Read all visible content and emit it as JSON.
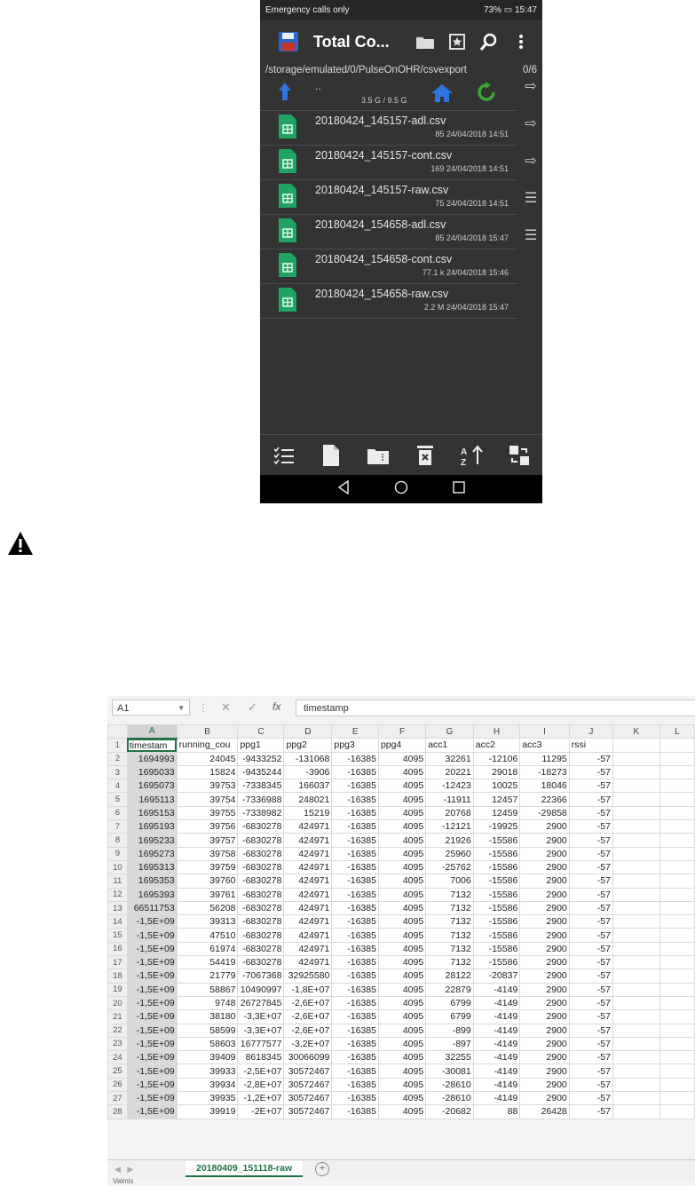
{
  "phone": {
    "status": {
      "left": "Emergency calls only",
      "battery": "73%",
      "time": "15:47"
    },
    "toolbar": {
      "title": "Total Co...",
      "icons": [
        "save-icon",
        "folder-icon",
        "bookmark-icon",
        "search-icon",
        "more-icon"
      ]
    },
    "path": "/storage/emulated/0/PulseOnOHR/csvexport",
    "count": "0/6",
    "updir": {
      "label": "..",
      "space": "3.5 G / 9.5 G"
    },
    "files": [
      {
        "name": "20180424_145157-adl.csv",
        "size": "85",
        "date": "24/04/2018 14:51"
      },
      {
        "name": "20180424_145157-cont.csv",
        "size": "169",
        "date": "24/04/2018 14:51"
      },
      {
        "name": "20180424_145157-raw.csv",
        "size": "75",
        "date": "24/04/2018 14:51"
      },
      {
        "name": "20180424_154658-adl.csv",
        "size": "85",
        "date": "24/04/2018 15:47"
      },
      {
        "name": "20180424_154658-cont.csv",
        "size": "77.1 k",
        "date": "24/04/2018 15:46"
      },
      {
        "name": "20180424_154658-raw.csv",
        "size": "2.2 M",
        "date": "24/04/2018 15:47"
      }
    ],
    "sidebar_glyphs": [
      "⇨",
      "⇨",
      "⇨",
      "☰",
      "☰"
    ]
  },
  "excel": {
    "namebox": "A1",
    "formula": "timestamp",
    "columns": [
      "A",
      "B",
      "C",
      "D",
      "E",
      "F",
      "G",
      "H",
      "I",
      "J",
      "K",
      "L"
    ],
    "rows": [
      [
        "timestam",
        "running_cou",
        "ppg1",
        "ppg2",
        "ppg3",
        "ppg4",
        "acc1",
        "acc2",
        "acc3",
        "rssi",
        "",
        ""
      ],
      [
        "1694993",
        "24045",
        "-9433252",
        "-131068",
        "-16385",
        "4095",
        "32261",
        "-12106",
        "11295",
        "-57",
        "",
        ""
      ],
      [
        "1695033",
        "15824",
        "-9435244",
        "-3906",
        "-16385",
        "4095",
        "20221",
        "29018",
        "-18273",
        "-57",
        "",
        ""
      ],
      [
        "1695073",
        "39753",
        "-7338345",
        "166037",
        "-16385",
        "4095",
        "-12423",
        "10025",
        "18046",
        "-57",
        "",
        ""
      ],
      [
        "1695113",
        "39754",
        "-7336988",
        "248021",
        "-16385",
        "4095",
        "-11911",
        "12457",
        "22366",
        "-57",
        "",
        ""
      ],
      [
        "1695153",
        "39755",
        "-7338982",
        "15219",
        "-16385",
        "4095",
        "20768",
        "12459",
        "-29858",
        "-57",
        "",
        ""
      ],
      [
        "1695193",
        "39756",
        "-6830278",
        "424971",
        "-16385",
        "4095",
        "-12121",
        "-19925",
        "2900",
        "-57",
        "",
        ""
      ],
      [
        "1695233",
        "39757",
        "-6830278",
        "424971",
        "-16385",
        "4095",
        "21926",
        "-15586",
        "2900",
        "-57",
        "",
        ""
      ],
      [
        "1695273",
        "39758",
        "-6830278",
        "424971",
        "-16385",
        "4095",
        "25960",
        "-15586",
        "2900",
        "-57",
        "",
        ""
      ],
      [
        "1695313",
        "39759",
        "-6830278",
        "424971",
        "-16385",
        "4095",
        "-25762",
        "-15586",
        "2900",
        "-57",
        "",
        ""
      ],
      [
        "1695353",
        "39760",
        "-6830278",
        "424971",
        "-16385",
        "4095",
        "7006",
        "-15586",
        "2900",
        "-57",
        "",
        ""
      ],
      [
        "1695393",
        "39761",
        "-6830278",
        "424971",
        "-16385",
        "4095",
        "7132",
        "-15586",
        "2900",
        "-57",
        "",
        ""
      ],
      [
        "66511753",
        "56208",
        "-6830278",
        "424971",
        "-16385",
        "4095",
        "7132",
        "-15586",
        "2900",
        "-57",
        "",
        ""
      ],
      [
        "-1,5E+09",
        "39313",
        "-6830278",
        "424971",
        "-16385",
        "4095",
        "7132",
        "-15586",
        "2900",
        "-57",
        "",
        ""
      ],
      [
        "-1,5E+09",
        "47510",
        "-6830278",
        "424971",
        "-16385",
        "4095",
        "7132",
        "-15586",
        "2900",
        "-57",
        "",
        ""
      ],
      [
        "-1,5E+09",
        "61974",
        "-6830278",
        "424971",
        "-16385",
        "4095",
        "7132",
        "-15586",
        "2900",
        "-57",
        "",
        ""
      ],
      [
        "-1,5E+09",
        "54419",
        "-6830278",
        "424971",
        "-16385",
        "4095",
        "7132",
        "-15586",
        "2900",
        "-57",
        "",
        ""
      ],
      [
        "-1,5E+09",
        "21779",
        "-7067368",
        "32925580",
        "-16385",
        "4095",
        "28122",
        "-20837",
        "2900",
        "-57",
        "",
        ""
      ],
      [
        "-1,5E+09",
        "58867",
        "10490997",
        "-1,8E+07",
        "-16385",
        "4095",
        "22879",
        "-4149",
        "2900",
        "-57",
        "",
        ""
      ],
      [
        "-1,5E+09",
        "9748",
        "26727845",
        "-2,6E+07",
        "-16385",
        "4095",
        "6799",
        "-4149",
        "2900",
        "-57",
        "",
        ""
      ],
      [
        "-1,5E+09",
        "38180",
        "-3,3E+07",
        "-2,6E+07",
        "-16385",
        "4095",
        "6799",
        "-4149",
        "2900",
        "-57",
        "",
        ""
      ],
      [
        "-1,5E+09",
        "58599",
        "-3,3E+07",
        "-2,6E+07",
        "-16385",
        "4095",
        "-899",
        "-4149",
        "2900",
        "-57",
        "",
        ""
      ],
      [
        "-1,5E+09",
        "58603",
        "16777577",
        "-3,2E+07",
        "-16385",
        "4095",
        "-897",
        "-4149",
        "2900",
        "-57",
        "",
        ""
      ],
      [
        "-1,5E+09",
        "39409",
        "8618345",
        "30066099",
        "-16385",
        "4095",
        "32255",
        "-4149",
        "2900",
        "-57",
        "",
        ""
      ],
      [
        "-1,5E+09",
        "39933",
        "-2,5E+07",
        "30572467",
        "-16385",
        "4095",
        "-30081",
        "-4149",
        "2900",
        "-57",
        "",
        ""
      ],
      [
        "-1,5E+09",
        "39934",
        "-2,8E+07",
        "30572467",
        "-16385",
        "4095",
        "-28610",
        "-4149",
        "2900",
        "-57",
        "",
        ""
      ],
      [
        "-1,5E+09",
        "39935",
        "-1,2E+07",
        "30572467",
        "-16385",
        "4095",
        "-28610",
        "-4149",
        "2900",
        "-57",
        "",
        ""
      ],
      [
        "-1,5E+09",
        "39919",
        "-2E+07",
        "30572467",
        "-16385",
        "4095",
        "-20682",
        "88",
        "26428",
        "-57",
        "",
        ""
      ]
    ],
    "sheet_tab": "20180409_151118-raw",
    "status": "Valmis"
  }
}
